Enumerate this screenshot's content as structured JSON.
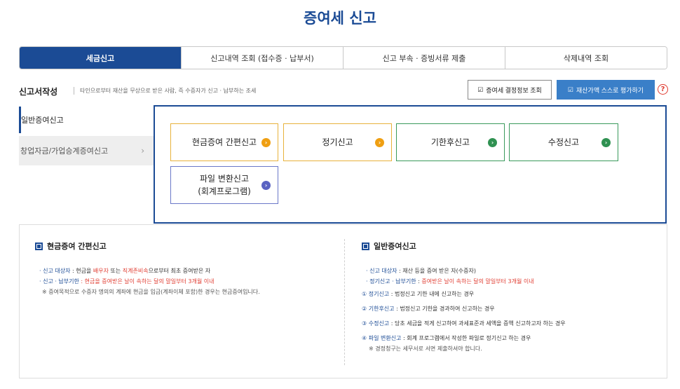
{
  "page_title": "증여세 신고",
  "tabs": [
    {
      "label": "세금신고",
      "active": true
    },
    {
      "label": "신고내역 조회 (접수증 · 납부서)",
      "active": false
    },
    {
      "label": "신고 부속 · 증빙서류 제출",
      "active": false
    },
    {
      "label": "삭제내역 조회",
      "active": false
    }
  ],
  "write": {
    "title": "신고서작성",
    "desc": "타인으로부터 재산을 무상으로 받은 사람, 즉 수증자가 신고 · 납부하는 조세",
    "decision_btn": "증여세 결정정보 조회",
    "evaluate_btn": "재산가액 스스로 평가하기",
    "help": "?"
  },
  "sidebar": {
    "items": [
      {
        "label": "일반증여신고"
      },
      {
        "label": "창업자금/가업승계증여신고"
      }
    ]
  },
  "cards": [
    {
      "label": "현금증여 간편신고",
      "color": "orange"
    },
    {
      "label": "정기신고",
      "color": "orange"
    },
    {
      "label": "기한후신고",
      "color": "green"
    },
    {
      "label": "수정신고",
      "color": "green"
    },
    {
      "label_line1": "파일 변환신고",
      "label_line2": "(회계프로그램)",
      "color": "blue"
    }
  ],
  "info_left": {
    "title": "현금증여 간편신고",
    "line1_key": "· 신고 대상자",
    "line1_a": " : 현금을 ",
    "line1_b": "배우자",
    "line1_c": " 또는 ",
    "line1_d": "직계존비속",
    "line1_e": "으로부터 최초 증여받은 자",
    "line2_key": "· 신고 · 납부기한",
    "line2_val": " : 현금을 증여받은 날이 속하는 달의 말일부터 3개월 이내",
    "note": "※ 증여목적으로 수증자 명의의 계좌에 현금을 입금(계좌이체 포함)한 경우는 현금증여입니다."
  },
  "info_right": {
    "title": "일반증여신고",
    "line1_key": "· 신고 대상자",
    "line1_val": " : 재산 등을 증여 받은 자(수증자)",
    "line2_key": "· 정기신고 · 납부기한",
    "line2_sep": " : ",
    "line2_val": "증여받은 날이 속하는 달의 말일부터 3개월 이내",
    "items": [
      {
        "num": "①",
        "key": "정기신고",
        "val": " : 법정신고 기한 내에 신고하는 경우"
      },
      {
        "num": "②",
        "key": "기한후신고",
        "val": " : 법정신고 기한을 경과하여 신고하는 경우"
      },
      {
        "num": "③",
        "key": "수정신고",
        "val": " : 당초 세금을 적게 신고하여 과세표준과 세액을 증액 신고하고자 하는 경우"
      },
      {
        "num": "④",
        "key": "파일 변환신고",
        "val": " : 회계 프로그램에서 작성한 파일로 정기신고 하는 경우"
      }
    ],
    "note": "※ 경정청구는 세무서로 서면 제출하셔야 합니다."
  }
}
